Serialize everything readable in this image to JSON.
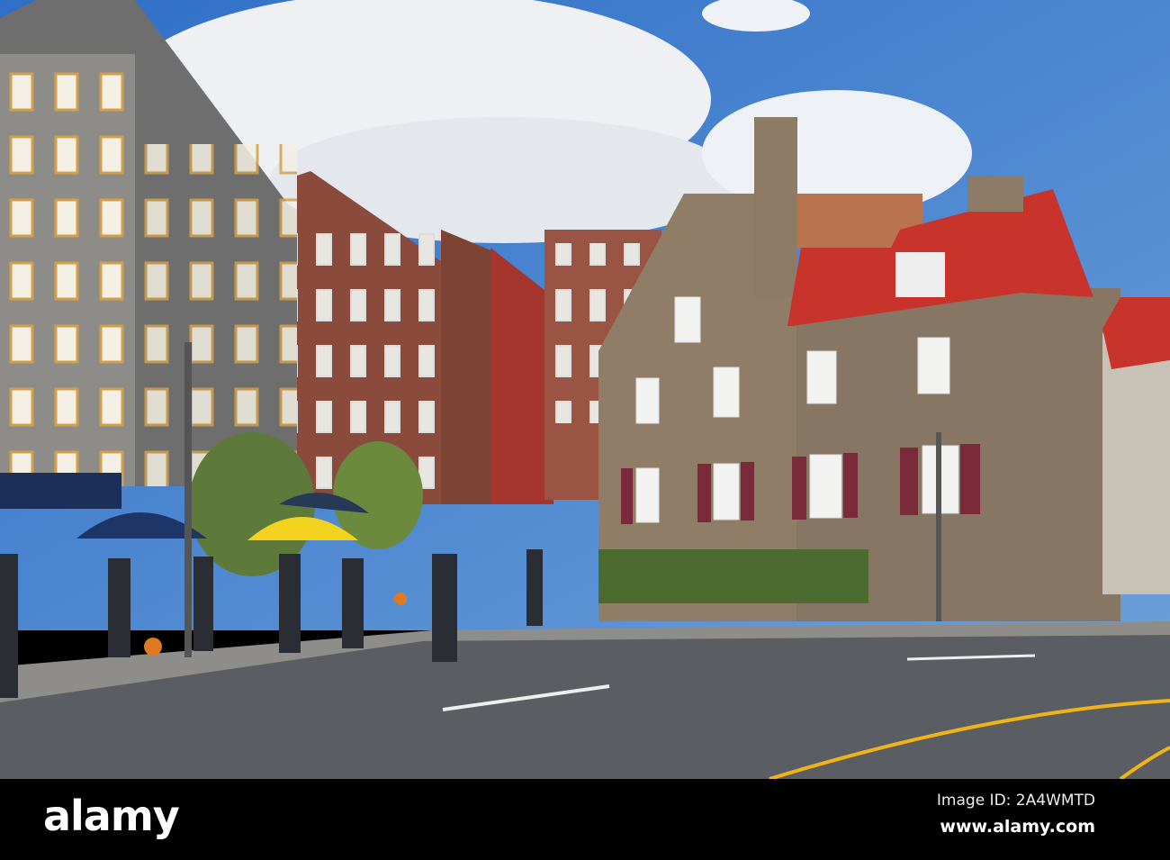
{
  "watermark": {
    "logo": "alamy",
    "image_id": "Image ID: 2A4WMTD",
    "site": "www.alamy.com"
  },
  "colors": {
    "sky": "#3f7fd0",
    "roof": "#c8342c",
    "stone": "#8a7a68",
    "brick": "#8e4a3a",
    "road": "#55585c",
    "line_yellow": "#f0b419"
  }
}
